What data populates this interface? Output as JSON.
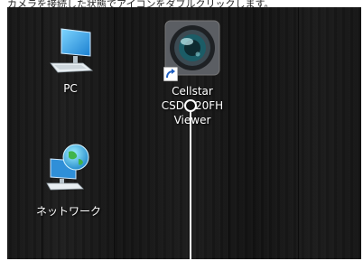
{
  "caption": {
    "text": "カメラを接続した状態でアイコンをダブルクリックします。"
  },
  "desktop": {
    "icons": [
      {
        "label": "PC"
      },
      {
        "label_lines": [
          "Cellstar",
          "CSD-120FH",
          "Viewer"
        ]
      },
      {
        "label": "ネットワーク"
      }
    ]
  },
  "colors": {
    "desktop_bg": "#181818",
    "label_text": "#ffffff",
    "callout": "#ffffff"
  }
}
